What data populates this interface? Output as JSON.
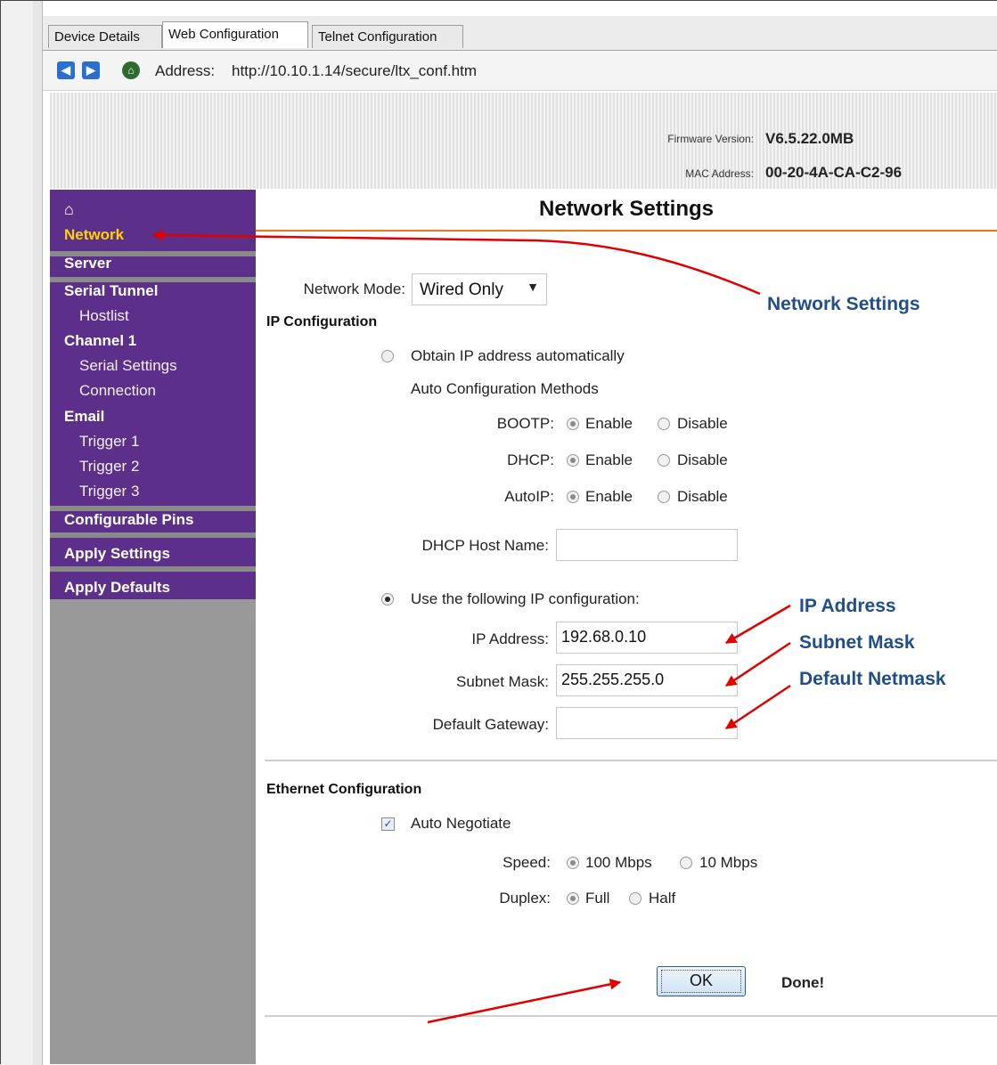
{
  "tabs": [
    "Device Details",
    "Web Configuration",
    "Telnet Configuration"
  ],
  "active_tab": "Web Configuration",
  "address": {
    "label": "Address:",
    "url": "http://10.10.1.14/secure/ltx_conf.htm"
  },
  "header": {
    "firmware_label": "Firmware Version:",
    "firmware_value": "V6.5.22.0MB",
    "mac_label": "MAC Address:",
    "mac_value": "00-20-4A-CA-C2-96"
  },
  "sidebar": {
    "items": [
      {
        "label": "Network",
        "level": "top",
        "active": true
      },
      {
        "label": "Server",
        "level": "top"
      },
      {
        "label": "Serial Tunnel",
        "level": "top"
      },
      {
        "label": "Hostlist",
        "level": "sub"
      },
      {
        "label": "Channel 1",
        "level": "top"
      },
      {
        "label": "Serial Settings",
        "level": "sub"
      },
      {
        "label": "Connection",
        "level": "sub"
      },
      {
        "label": "Email",
        "level": "top"
      },
      {
        "label": "Trigger 1",
        "level": "sub"
      },
      {
        "label": "Trigger 2",
        "level": "sub"
      },
      {
        "label": "Trigger 3",
        "level": "sub"
      },
      {
        "label": "Configurable Pins",
        "level": "top"
      },
      {
        "label": "Apply Settings",
        "level": "top"
      },
      {
        "label": "Apply Defaults",
        "level": "top"
      }
    ]
  },
  "main": {
    "title": "Network Settings",
    "network_mode_label": "Network Mode:",
    "network_mode_value": "Wired Only",
    "ip_config_heading": "IP Configuration",
    "obtain_auto_label": "Obtain IP address automatically",
    "auto_methods_label": "Auto Configuration Methods",
    "bootp_label": "BOOTP:",
    "dhcp_label": "DHCP:",
    "autoip_label": "AutoIP:",
    "enable_label": "Enable",
    "disable_label": "Disable",
    "dhcp_host_label": "DHCP Host Name:",
    "dhcp_host_value": "",
    "use_following_label": "Use the following IP configuration:",
    "ip_address_label": "IP Address:",
    "ip_address_value": "192.68.0.10",
    "subnet_label": "Subnet Mask:",
    "subnet_value": "255.255.255.0",
    "gateway_label": "Default Gateway:",
    "gateway_value": "",
    "ethernet_heading": "Ethernet Configuration",
    "auto_negotiate_label": "Auto Negotiate",
    "auto_negotiate_checked": true,
    "speed_label": "Speed:",
    "speed_100": "100 Mbps",
    "speed_10": "10 Mbps",
    "duplex_label": "Duplex:",
    "duplex_full": "Full",
    "duplex_half": "Half",
    "ok_label": "OK",
    "status_text": "Done!"
  },
  "annotations": {
    "network_settings": "Network Settings",
    "ip_address": "IP Address",
    "subnet_mask": "Subnet Mask",
    "default_netmask": "Default Netmask"
  },
  "colors": {
    "sidebar_purple": "#5c2f8a",
    "active_nav": "#ffd200",
    "title_underline": "#e87722",
    "annotation_text": "#1f4e8c",
    "arrow": "#e00000"
  }
}
